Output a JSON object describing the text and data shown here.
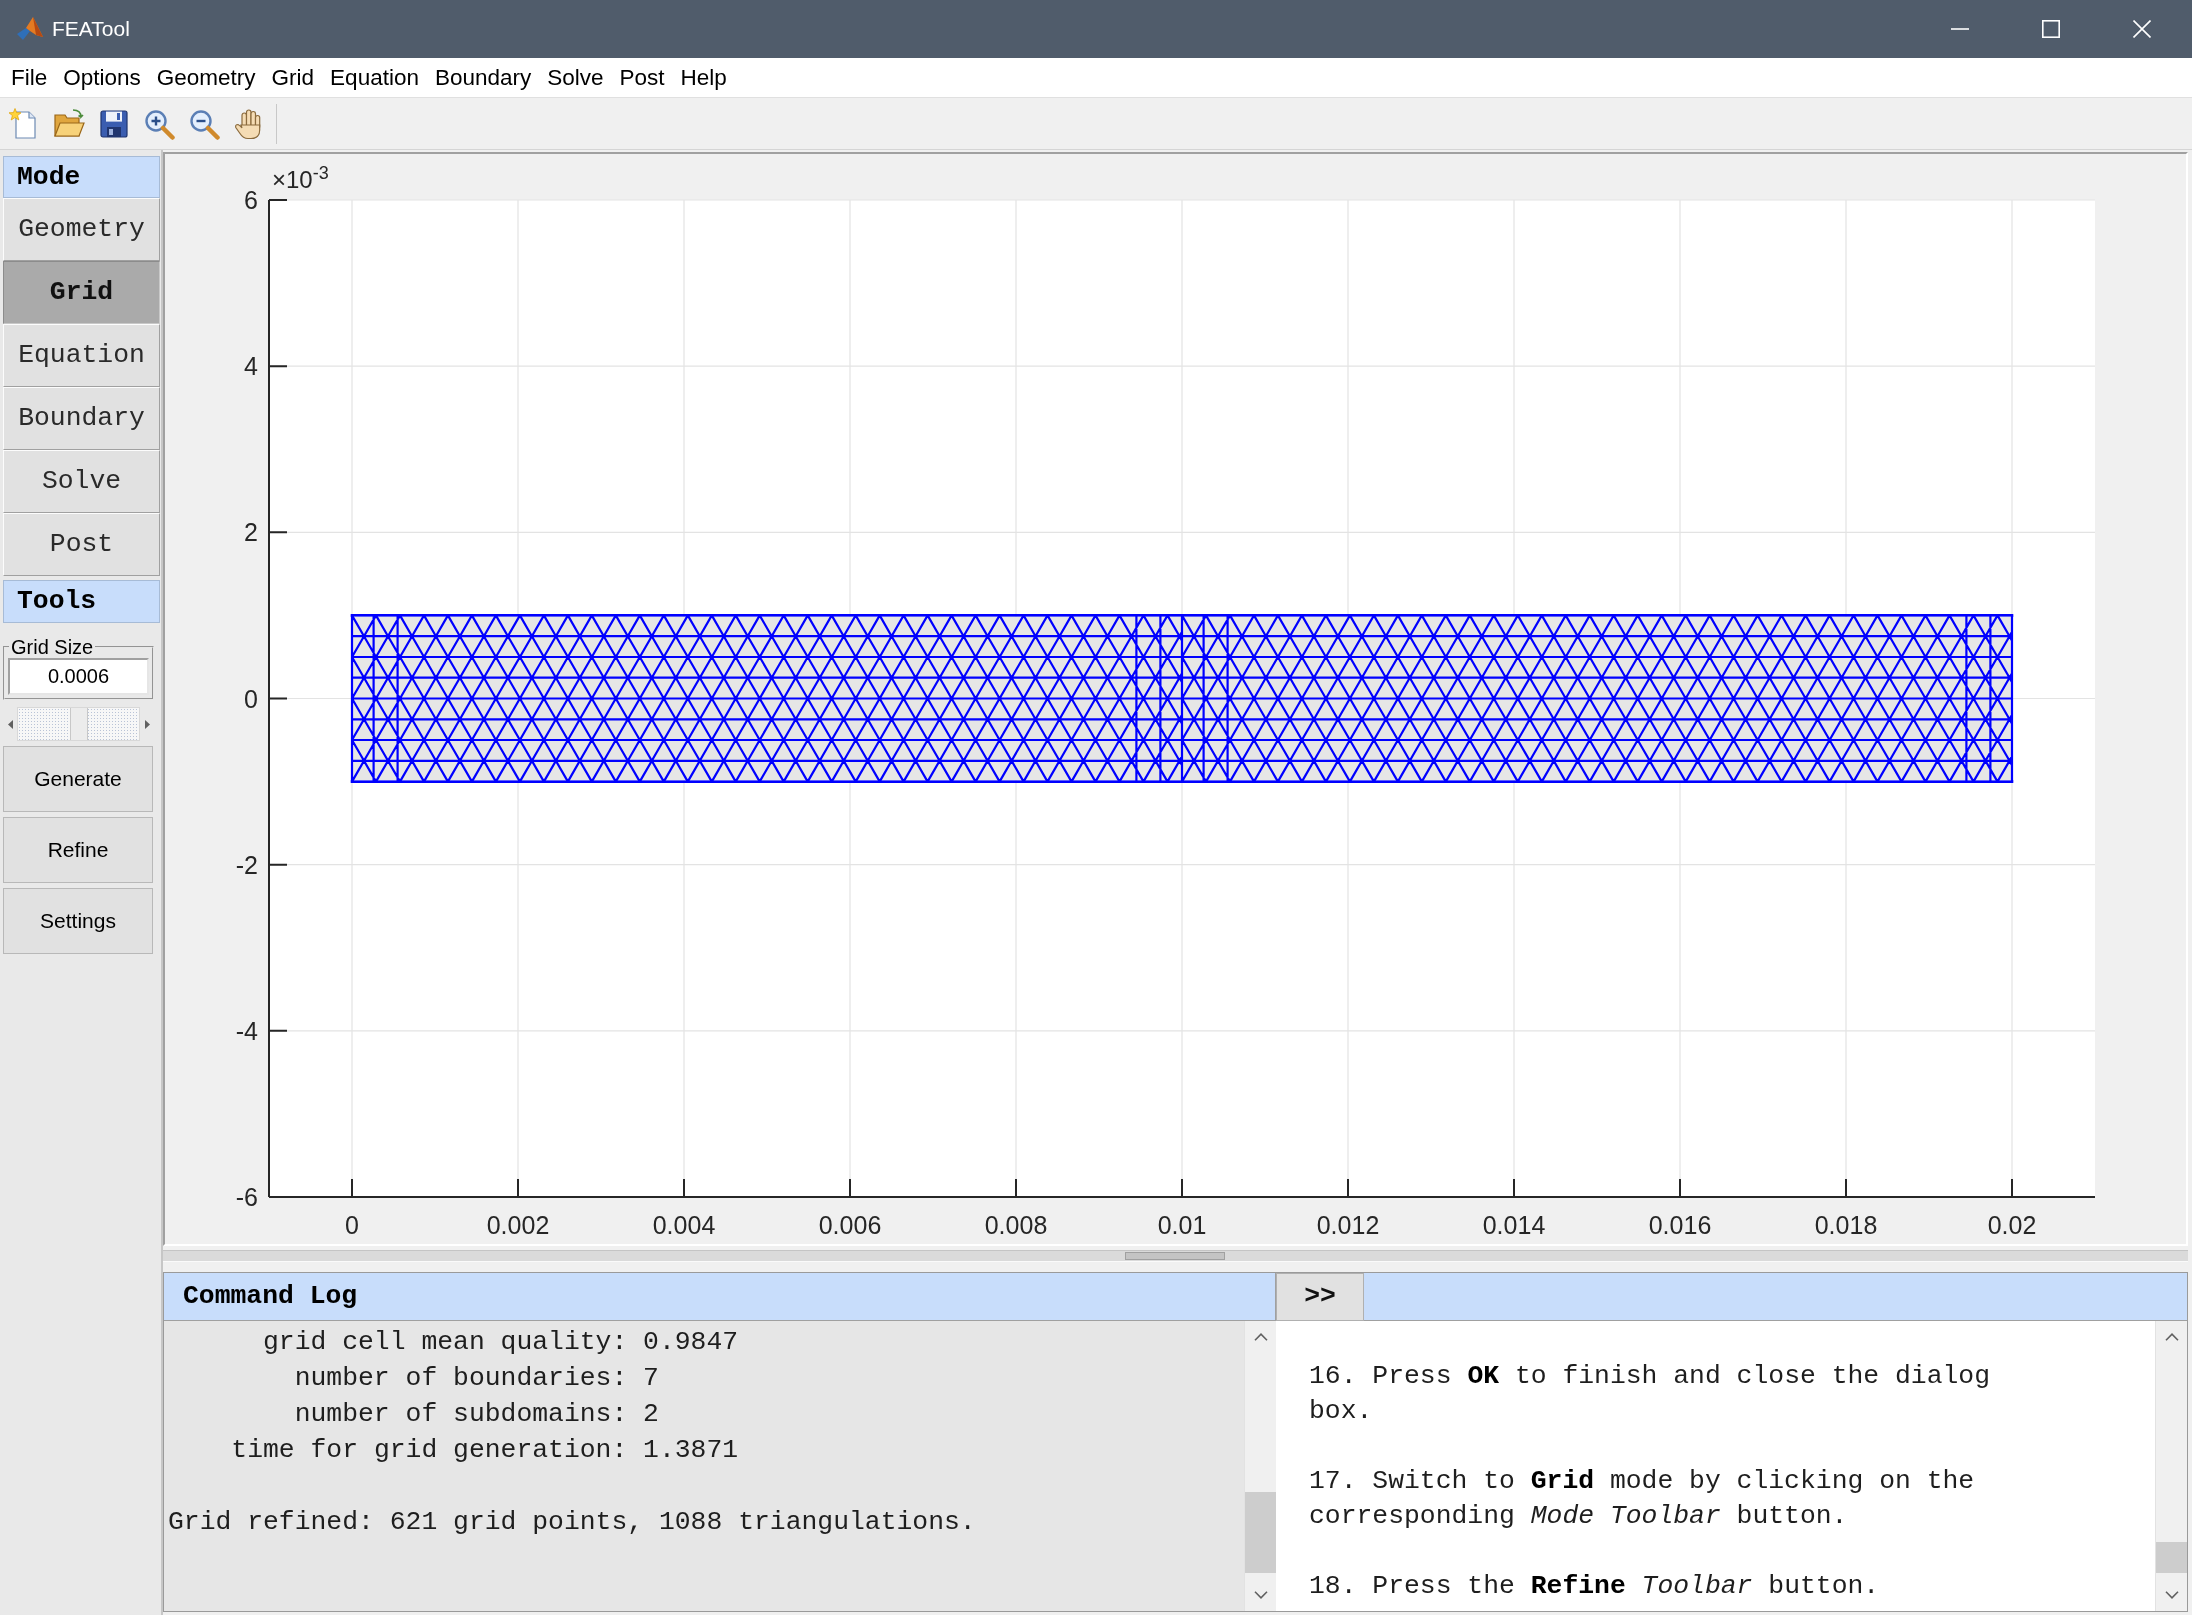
{
  "window": {
    "title": "FEATool"
  },
  "menu": [
    "File",
    "Options",
    "Geometry",
    "Grid",
    "Equation",
    "Boundary",
    "Solve",
    "Post",
    "Help"
  ],
  "mode_toolbar": {
    "title": "Mode",
    "buttons": [
      {
        "label": "Geometry",
        "selected": false
      },
      {
        "label": "Grid",
        "selected": true
      },
      {
        "label": "Equation",
        "selected": false
      },
      {
        "label": "Boundary",
        "selected": false
      },
      {
        "label": "Solve",
        "selected": false
      },
      {
        "label": "Post",
        "selected": false
      }
    ]
  },
  "tools": {
    "title": "Tools",
    "grid_size": {
      "label": "Grid Size",
      "value": "0.0006",
      "slider": {
        "level": 0.5
      }
    },
    "buttons": [
      "Generate",
      "Refine",
      "Settings"
    ]
  },
  "plot": {
    "exponent_label": "×10$^{-3}$",
    "chart_data": {
      "type": "line",
      "grid": true,
      "xlim": [
        -0.001,
        0.021
      ],
      "ylim": [
        -6,
        6
      ],
      "xticks": [
        0,
        0.002,
        0.004,
        0.006,
        0.008,
        0.01,
        0.012,
        0.014,
        0.016,
        0.018,
        0.02
      ],
      "yticks": [
        -6,
        -4,
        -2,
        0,
        2,
        4,
        6
      ],
      "x": [
        0,
        0.02
      ],
      "series": [
        {
          "color": "#0000ff",
          "values": [
            1,
            1
          ]
        },
        {
          "color": "#0000ff",
          "values": [
            -1,
            -1
          ]
        }
      ]
    }
  },
  "command_log": {
    "title": "Command Log",
    "lines": [
      {
        "kind": "stat",
        "text": "grid cell mean quality: 0.9847"
      },
      {
        "kind": "stat",
        "text": "number of boundaries: 7"
      },
      {
        "kind": "stat",
        "text": "number of subdomains: 2"
      },
      {
        "kind": "stat",
        "text": "time for grid generation: 1.3871"
      },
      {
        "kind": "message",
        "text": "Grid refined: 621 grid points, 1088 triangulations."
      }
    ]
  },
  "help_panel": {
    "toggle": ">>",
    "steps": [
      "16. Press **OK** to finish and close the dialog box.",
      "17. Switch to **Grid** mode by clicking on the corresponding *Mode Toolbar* button.",
      "18. Press the **Refine** *Toolbar* button."
    ]
  }
}
